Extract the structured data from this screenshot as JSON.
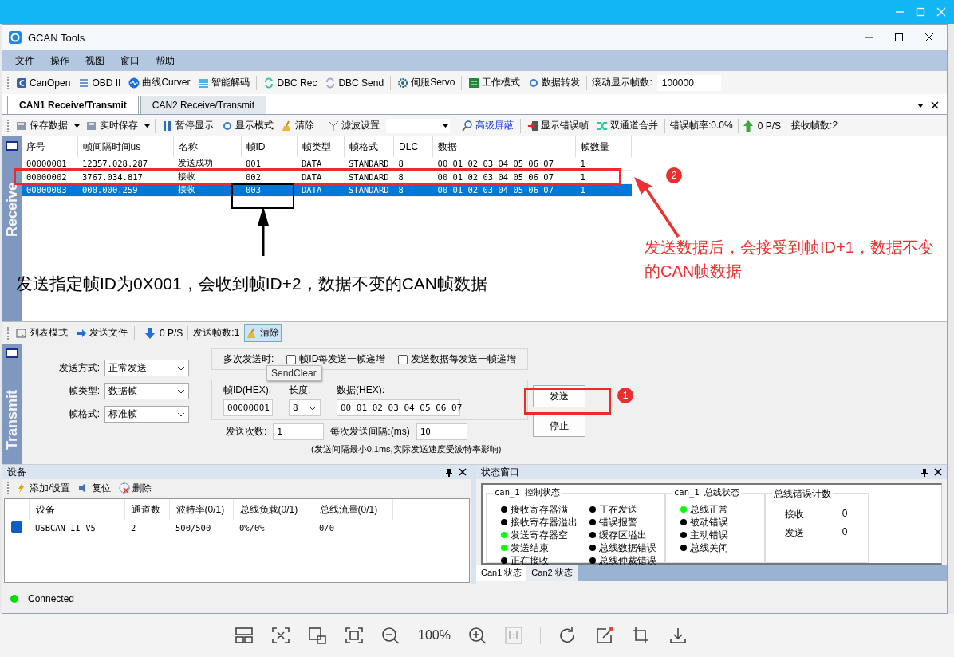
{
  "viewer": {
    "zoom": "100%"
  },
  "window": {
    "title": "GCAN Tools"
  },
  "menu": [
    "文件",
    "操作",
    "视图",
    "窗口",
    "帮助"
  ],
  "toolbar": [
    {
      "label": "CanOpen"
    },
    {
      "label": "OBD II"
    },
    {
      "label": "曲线Curver"
    },
    {
      "label": "智能解码"
    },
    {
      "label": "DBC Rec"
    },
    {
      "label": "DBC Send"
    },
    {
      "label": "伺服Servo"
    },
    {
      "label": "工作模式"
    },
    {
      "label": "数据转发"
    }
  ],
  "scroll_frames": {
    "label": "滚动显示帧数:",
    "value": "100000"
  },
  "tabs": [
    {
      "label": "CAN1 Receive/Transmit",
      "selected": true
    },
    {
      "label": "CAN2 Receive/Transmit",
      "selected": false
    }
  ],
  "receive_toolbar": {
    "save": "保存数据",
    "realtime_save": "实时保存",
    "pause": "暂停显示",
    "display_mode": "显示模式",
    "clear": "清除",
    "filter": "滤波设置",
    "advanced_mask": "高级屏蔽",
    "show_errors": "显示错误帧",
    "merge": "双通道合并",
    "error_rate": "错误帧率:0.0%",
    "rate": "0 P/S",
    "received": "接收帧数:2"
  },
  "receive_label": "Receive",
  "table": {
    "columns": [
      "序号",
      "帧间隔时间us",
      "名称",
      "帧ID",
      "帧类型",
      "帧格式",
      "DLC",
      "数据",
      "帧数量"
    ],
    "rows": [
      {
        "cells": [
          "00000001",
          "12357.028.287",
          "发送成功",
          "001",
          "DATA",
          "STANDARD",
          "8",
          "00 01 02 03 04 05 06 07",
          "1"
        ],
        "selected": false
      },
      {
        "cells": [
          "00000002",
          "3767.034.817",
          "接收",
          "002",
          "DATA",
          "STANDARD",
          "8",
          "00 01 02 03 04 05 06 07",
          "1"
        ],
        "selected": false
      },
      {
        "cells": [
          "00000003",
          "000.000.259",
          "接收",
          "003",
          "DATA",
          "STANDARD",
          "8",
          "00 01 02 03 04 05 06 07",
          "1"
        ],
        "selected": true
      }
    ]
  },
  "send_toolbar": {
    "list_mode": "列表模式",
    "send_file": "发送文件",
    "rate": "0 P/S",
    "sent": "发送帧数:1",
    "clear": "清除"
  },
  "transmit_label": "Transmit",
  "transmit": {
    "fields": [
      {
        "label": "发送方式:",
        "value": "正常发送"
      },
      {
        "label": "帧类型:",
        "value": "数据帧"
      },
      {
        "label": "帧格式:",
        "value": "标准帧"
      }
    ],
    "multi_label": "多次发送时:",
    "checks": [
      {
        "label": "帧ID每发送一帧递增",
        "checked": false
      },
      {
        "label": "发送数据每发送一帧递增",
        "checked": false
      }
    ],
    "id_label": "帧ID(HEX):",
    "id_value": "00000001",
    "length_label": "长度:",
    "length_value": "8",
    "data_label": "数据(HEX):",
    "data_value": "00 01 02 03 04 05 06 07",
    "send": "发送",
    "stop": "停止",
    "count_label": "发送次数:",
    "count_value": "1",
    "interval_label": "每次发送间隔:(ms)",
    "interval_value": "10",
    "note": "(发送间隔最小0.1ms,实际发送速度受波特率影响)",
    "tooltip": "SendClear"
  },
  "device_panel": {
    "title": "设备",
    "add": "添加/设置",
    "reset": "复位",
    "delete": "删除",
    "columns": [
      "设备",
      "通道数",
      "波特率(0/1)",
      "总线负载(0/1)",
      "总线流量(0/1)"
    ],
    "rows": [
      {
        "checked": true,
        "cells": [
          "USBCAN-II-V5",
          "2",
          "500/500",
          "0%/0%",
          "0/0"
        ]
      }
    ]
  },
  "status_panel": {
    "title": "状态窗口",
    "groups": [
      {
        "title": "can_1 控制状态",
        "kind": "indicators",
        "items": [
          {
            "label": "接收寄存器满",
            "color": "#000000"
          },
          {
            "label": "接收寄存器溢出",
            "color": "#000000"
          },
          {
            "label": "发送寄存器空",
            "color": "#00ff00"
          },
          {
            "label": "发送结束",
            "color": "#00ff00"
          },
          {
            "label": "正在接收",
            "color": "#000000"
          },
          {
            "label": "正在发送",
            "color": "#000000"
          },
          {
            "label": "错误报警",
            "color": "#000000"
          },
          {
            "label": "缓存区溢出",
            "color": "#000000"
          },
          {
            "label": "总线数据错误",
            "color": "#000000"
          },
          {
            "label": "总线仲裁错误",
            "color": "#000000"
          }
        ]
      },
      {
        "title": "can_1 总线状态",
        "kind": "indicators",
        "items": [
          {
            "label": "总线正常",
            "color": "#00ff00"
          },
          {
            "label": "被动错误",
            "color": "#000000"
          },
          {
            "label": "主动错误",
            "color": "#000000"
          },
          {
            "label": "总线关闭",
            "color": "#000000"
          }
        ]
      },
      {
        "title": "总线错误计数",
        "kind": "counters",
        "items": [
          {
            "label": "接收",
            "value": "0"
          },
          {
            "label": "发送",
            "value": "0"
          }
        ]
      }
    ],
    "tabs": [
      {
        "label": "Can1 状态",
        "selected": true
      },
      {
        "label": "Can2 状态",
        "selected": false
      }
    ]
  },
  "status_bar": {
    "text": "Connected",
    "connected": true
  },
  "annotations": {
    "left_note": "发送指定帧ID为0X001，会收到帧ID+2，数据不变的CAN帧数据",
    "right_note": "发送数据后，会接受到帧ID+1，数据不变的CAN帧数据",
    "markers": [
      "1",
      "2"
    ]
  }
}
